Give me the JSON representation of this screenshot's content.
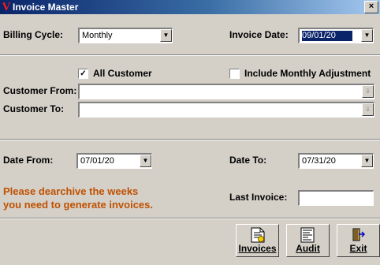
{
  "window": {
    "title": "Invoice Master",
    "close_glyph": "×"
  },
  "billing": {
    "label": "Billing Cycle:",
    "value": "Monthly"
  },
  "invoice_date": {
    "label": "Invoice Date:",
    "value": "09/01/20"
  },
  "all_customer": {
    "label": "All Customer",
    "checked": true,
    "mark": "✓"
  },
  "monthly_adj": {
    "label": "Include Monthly Adjustment",
    "checked": false
  },
  "customer_from": {
    "label": "Customer From:",
    "value": ""
  },
  "customer_to": {
    "label": "Customer To:",
    "value": ""
  },
  "date_from": {
    "label": "Date From:",
    "value": "07/01/20"
  },
  "date_to": {
    "label": "Date To:",
    "value": "07/31/20"
  },
  "notice": {
    "line1": "Please dearchive the weeks",
    "line2": "you need to generate invoices."
  },
  "last_invoice": {
    "label": "Last Invoice:",
    "value": ""
  },
  "buttons": {
    "invoices": "Invoices",
    "audit": "Audit",
    "exit": "Exit"
  },
  "glyphs": {
    "dropdown": "▼",
    "spin": "⇓"
  }
}
